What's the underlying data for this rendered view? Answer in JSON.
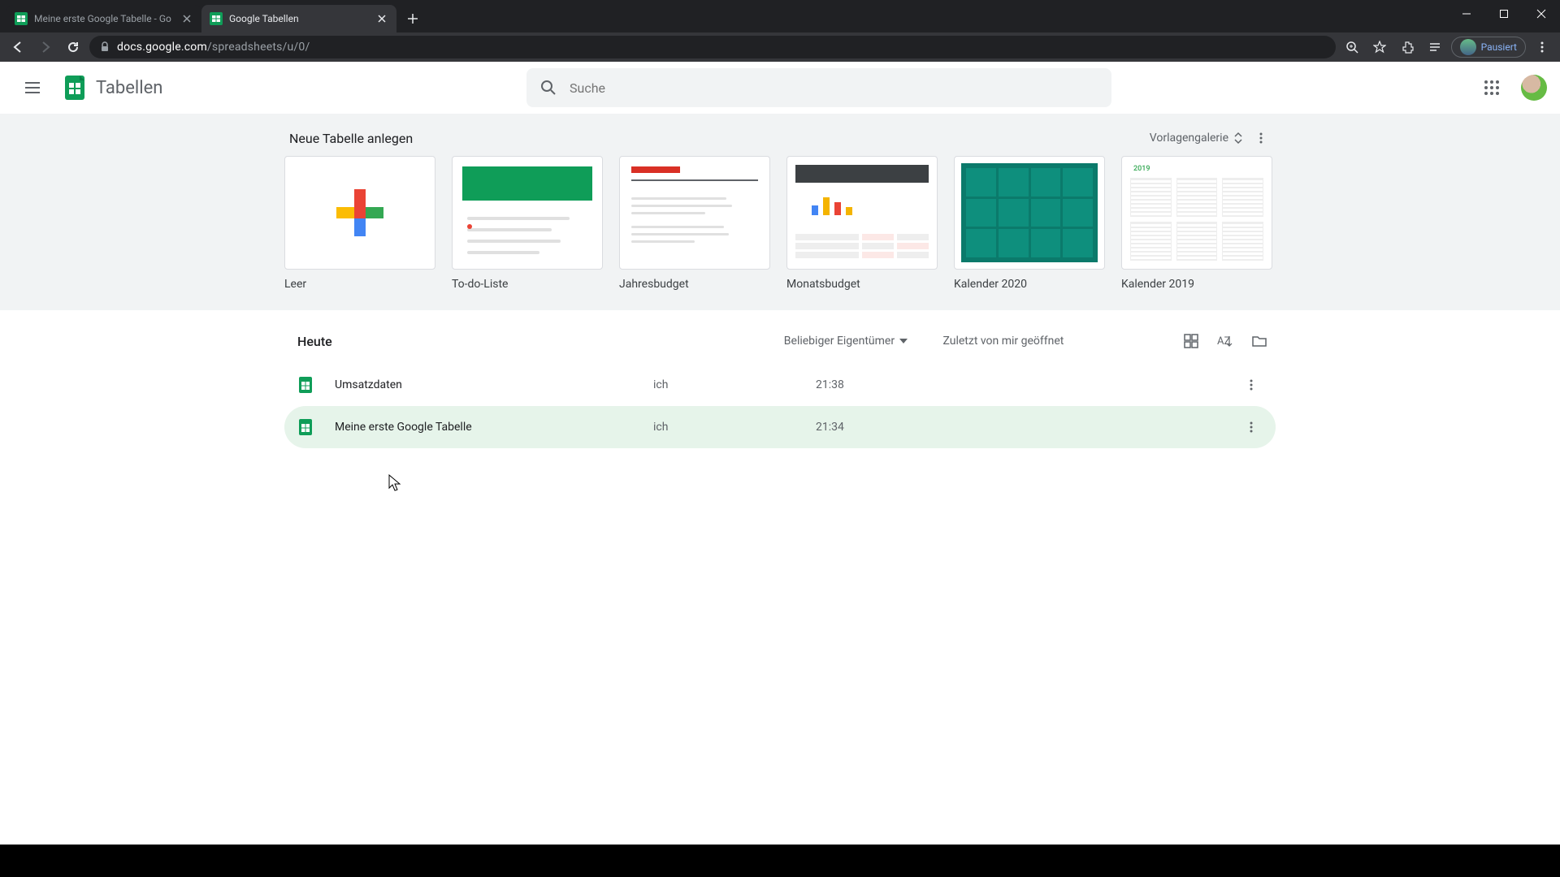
{
  "browser": {
    "tabs": [
      {
        "title": "Meine erste Google Tabelle - Go",
        "active": false
      },
      {
        "title": "Google Tabellen",
        "active": true
      }
    ],
    "url_host": "docs.google.com",
    "url_path": "/spreadsheets/u/0/",
    "profile_label": "Pausiert"
  },
  "header": {
    "app_title": "Tabellen",
    "search_placeholder": "Suche"
  },
  "templates": {
    "section_title": "Neue Tabelle anlegen",
    "gallery_label": "Vorlagengalerie",
    "items": [
      {
        "label": "Leer"
      },
      {
        "label": "To-do-Liste"
      },
      {
        "label": "Jahresbudget"
      },
      {
        "label": "Monatsbudget"
      },
      {
        "label": "Kalender 2020"
      },
      {
        "label": "Kalender 2019",
        "badge": "2019"
      }
    ]
  },
  "docs": {
    "section_title": "Heute",
    "owner_filter": "Beliebiger Eigentümer",
    "opened_label": "Zuletzt von mir geöffnet",
    "rows": [
      {
        "name": "Umsatzdaten",
        "owner": "ich",
        "time": "21:38"
      },
      {
        "name": "Meine erste Google Tabelle",
        "owner": "ich",
        "time": "21:34"
      }
    ]
  }
}
